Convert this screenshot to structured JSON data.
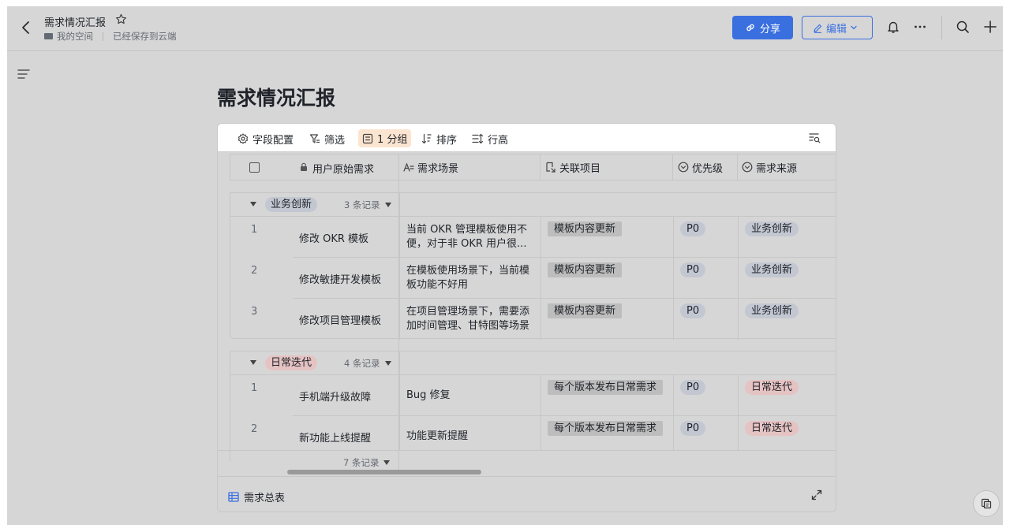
{
  "header": {
    "doc_title": "需求情况汇报",
    "breadcrumb_space": "我的空间",
    "save_status": "已经保存到云端",
    "share_label": "分享",
    "edit_label": "编辑"
  },
  "page": {
    "title": "需求情况汇报"
  },
  "toolbar": {
    "field_config": "字段配置",
    "filter": "筛选",
    "group": "1 分组",
    "sort": "排序",
    "row_height": "行高"
  },
  "columns": {
    "user_req": "用户原始需求",
    "scene": "需求场景",
    "project": "关联项目",
    "priority": "优先级",
    "source": "需求来源"
  },
  "groups": [
    {
      "name": "业务创新",
      "count": "3 条记录",
      "rows": [
        {
          "idx": "1",
          "req": "修改 OKR 模板",
          "scene": "当前 OKR 管理模板使用不便，对于非 OKR 用户很...",
          "project": "模板内容更新",
          "priority": "P0",
          "source": "业务创新"
        },
        {
          "idx": "2",
          "req": "修改敏捷开发模板",
          "scene": "在模板使用场景下，当前模板功能不好用",
          "project": "模板内容更新",
          "priority": "P0",
          "source": "业务创新"
        },
        {
          "idx": "3",
          "req": "修改项目管理模板",
          "scene": "在项目管理场景下，需要添加时间管理、甘特图等场景",
          "project": "模板内容更新",
          "priority": "P0",
          "source": "业务创新"
        }
      ]
    },
    {
      "name": "日常迭代",
      "count": "4 条记录",
      "rows": [
        {
          "idx": "1",
          "req": "手机端升级故障",
          "scene": "Bug 修复",
          "project": "每个版本发布日常需求",
          "priority": "P0",
          "source": "日常迭代"
        },
        {
          "idx": "2",
          "req": "新功能上线提醒",
          "scene": "功能更新提醒",
          "project": "每个版本发布日常需求",
          "priority": "P0",
          "source": "日常迭代"
        }
      ]
    }
  ],
  "footer": {
    "total_count": "7 条记录",
    "sheet_name": "需求总表"
  },
  "colors": {
    "accent": "#3a6fe0",
    "tag_blue": "#c3c7d1",
    "tag_red": "#e6c3c3",
    "group_highlight": "#fbe5d0"
  }
}
